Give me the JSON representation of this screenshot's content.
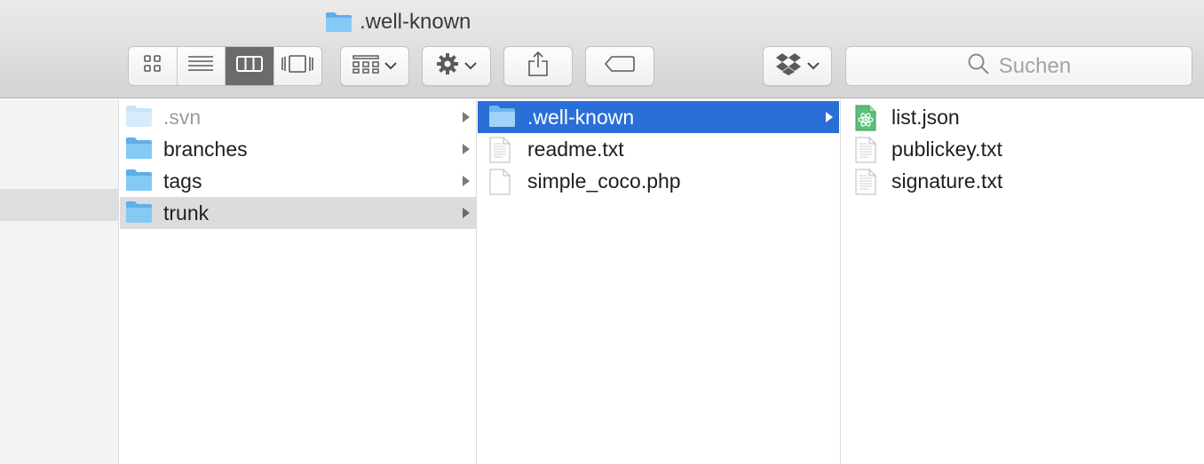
{
  "window": {
    "title": ".well-known"
  },
  "toolbar": {
    "view_buttons": [
      {
        "name": "icon-view",
        "icon": "grid-icon",
        "selected": false
      },
      {
        "name": "list-view",
        "icon": "list-icon",
        "selected": false
      },
      {
        "name": "column-view",
        "icon": "columns-icon",
        "selected": true
      },
      {
        "name": "gallery-view",
        "icon": "coverflow-icon",
        "selected": false
      }
    ],
    "arrange_icon": "arrange-grid-icon",
    "action_icon": "gear-icon",
    "share_icon": "share-icon",
    "tags_icon": "tag-icon",
    "dropbox_icon": "dropbox-icon"
  },
  "search": {
    "placeholder": "Suchen"
  },
  "columns": {
    "col1": [
      {
        "label": ".svn",
        "type": "folder",
        "hidden": true
      },
      {
        "label": "branches",
        "type": "folder"
      },
      {
        "label": "tags",
        "type": "folder"
      },
      {
        "label": "trunk",
        "type": "folder",
        "selected": "inactive"
      }
    ],
    "col2": [
      {
        "label": ".well-known",
        "type": "folder",
        "selected": "active"
      },
      {
        "label": "readme.txt",
        "type": "text-file"
      },
      {
        "label": "simple_coco.php",
        "type": "blank-file"
      }
    ],
    "col3": [
      {
        "label": "list.json",
        "type": "json-file"
      },
      {
        "label": "publickey.txt",
        "type": "text-file"
      },
      {
        "label": "signature.txt",
        "type": "text-file"
      }
    ]
  },
  "colors": {
    "selection_active": "#2a6ed7",
    "selection_inactive": "#dcdcdc",
    "folder_blue": "#7cc4f4"
  }
}
